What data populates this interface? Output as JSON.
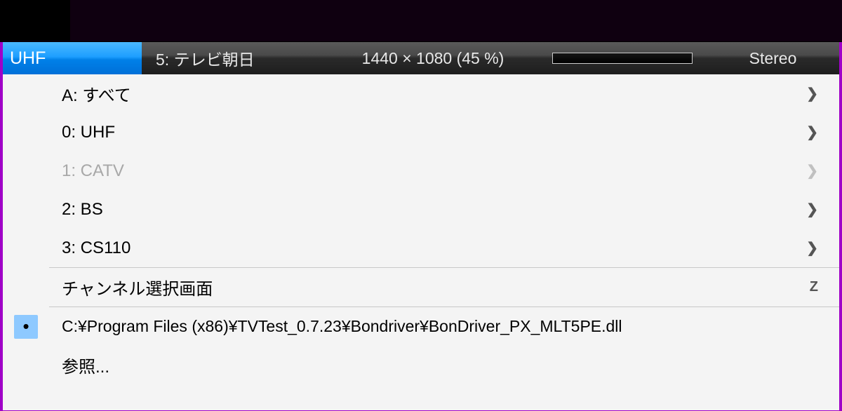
{
  "statusbar": {
    "tuner": "UHF",
    "channel": "5: テレビ朝日",
    "resolution": "1440 × 1080 (45 %)",
    "audio": "Stereo"
  },
  "menu": {
    "items": [
      {
        "label": "A: すべて",
        "submenu": true,
        "disabled": false
      },
      {
        "label": "0: UHF",
        "submenu": true,
        "disabled": false
      },
      {
        "label": "1: CATV",
        "submenu": true,
        "disabled": true
      },
      {
        "label": "2: BS",
        "submenu": true,
        "disabled": false
      },
      {
        "label": "3: CS110",
        "submenu": true,
        "disabled": false
      }
    ],
    "channel_select": {
      "label": "チャンネル選択画面",
      "shortcut": "Z"
    },
    "driver_path": "C:¥Program Files (x86)¥TVTest_0.7.23¥Bondriver¥BonDriver_PX_MLT5PE.dll",
    "browse": "参照..."
  }
}
